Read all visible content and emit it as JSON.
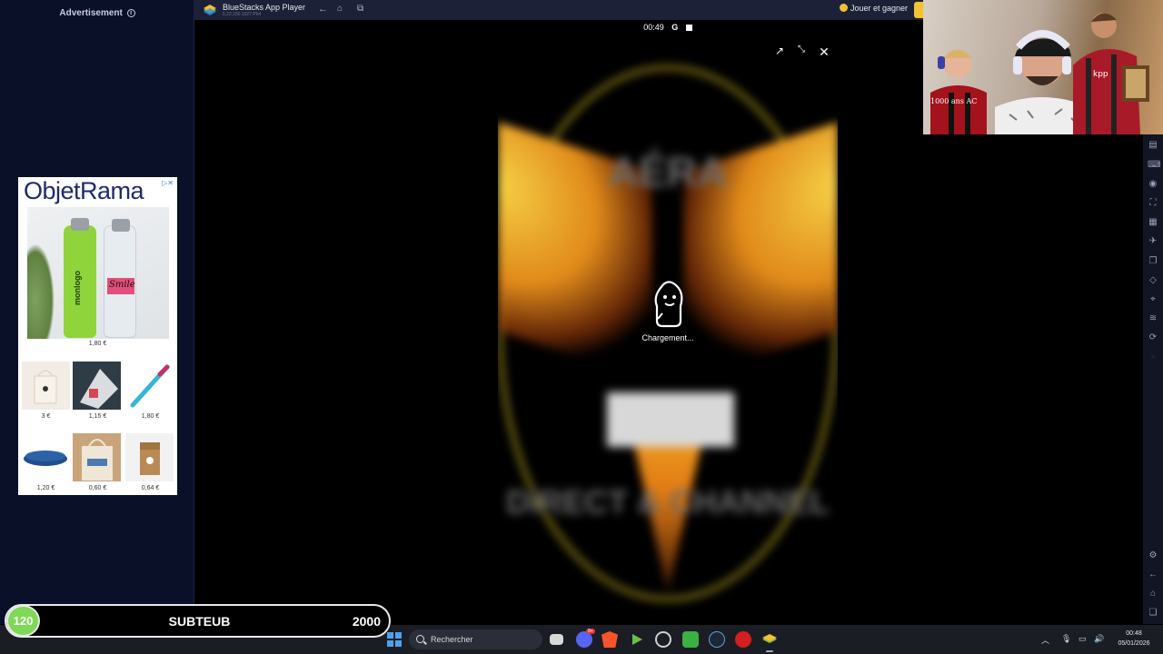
{
  "ad": {
    "header": "Advertisement",
    "info_icon": "info-icon",
    "brand": "ObjetRama",
    "hero_price": "1,80 €",
    "hero_bottle_text_1": "monlogo",
    "hero_bottle_text_2": "Smile",
    "products": [
      {
        "price": "3 €",
        "icon": "tote-bag-icon"
      },
      {
        "price": "1,15 €",
        "icon": "notebook-icon"
      },
      {
        "price": "1,80 €",
        "icon": "pen-icon"
      },
      {
        "price": "1,20 €",
        "icon": "blanket-icon"
      },
      {
        "price": "0,60 €",
        "icon": "cotton-bag-icon"
      },
      {
        "price": "0,64 €",
        "icon": "paper-bag-icon"
      }
    ]
  },
  "bluestacks": {
    "title": "BlueStacks App Player",
    "subtitle": "5.22.150.1027 P64",
    "play_earn": "Jouer et gagner",
    "colors": {
      "bar": "#1d2138",
      "accent": "#f3c131"
    }
  },
  "phone": {
    "time": "00:49",
    "status_icons": [
      "google-icon",
      "notification-icon"
    ],
    "art_title": "AÉRA",
    "art_bottom": "DIRECT & CHANNEL",
    "loading_text": "Chargement..."
  },
  "webcam": {
    "caption": "1000 ans AC",
    "shirt_text": "kpp"
  },
  "sub_goal": {
    "current": "120",
    "label": "SUBTEUB",
    "goal": "2000",
    "badge_color": "#7ed957"
  },
  "taskbar": {
    "search_placeholder": "Rechercher",
    "discord_badge": "9+",
    "time": "00:48",
    "date": "05/01/2026"
  }
}
